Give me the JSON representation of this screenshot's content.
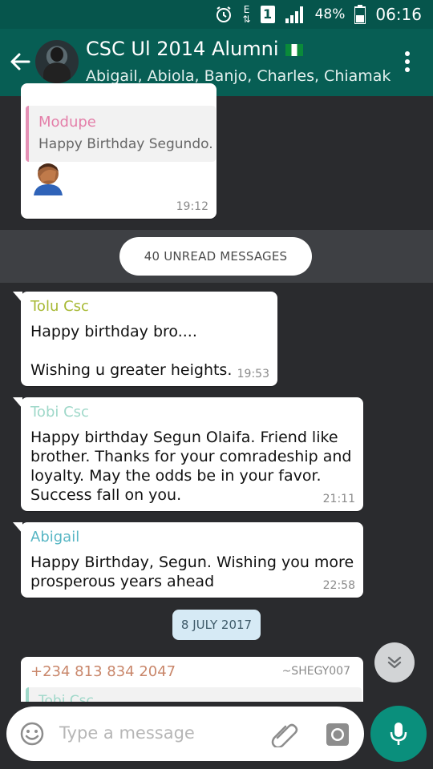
{
  "status_bar": {
    "battery_percent": "48%",
    "time": "06:16",
    "sim_badge": "1",
    "network": "E"
  },
  "header": {
    "title": "CSC Ul 2014 Alumni",
    "participants": "Abigail, Abiola, Banjo, Charles, Chiamak…"
  },
  "chat": {
    "first_message": {
      "quoted_sender": "Modupe",
      "quoted_text": "Happy Birthday Segundo.",
      "time": "19:12"
    },
    "unread_label": "40 UNREAD MESSAGES",
    "messages": [
      {
        "sender": "Tolu Csc",
        "line1": "Happy birthday bro....",
        "line2": "Wishing u greater heights.",
        "time": "19:53"
      },
      {
        "sender": "Tobi Csc",
        "lines": [
          "Happy birthday Segun Olaifa. Friend like",
          "brother. Thanks for your comradeship and",
          "loyalty. May the odds be in your favor.",
          "Success fall on you."
        ],
        "time": "21:11"
      },
      {
        "sender": "Abigail",
        "lines": [
          "Happy Birthday, Segun. Wishing you more",
          "prosperous years ahead"
        ],
        "time": "22:58"
      }
    ],
    "date_divider": "8 JULY 2017",
    "last_message": {
      "sender": "+234 813 834 2047",
      "alias": "~SHEGY007",
      "quoted_partial": "Tobi Csc"
    }
  },
  "composer": {
    "placeholder": "Type a message"
  },
  "colors": {
    "header": "#075e54",
    "status": "#06554c",
    "accent": "#0a8f7c"
  }
}
